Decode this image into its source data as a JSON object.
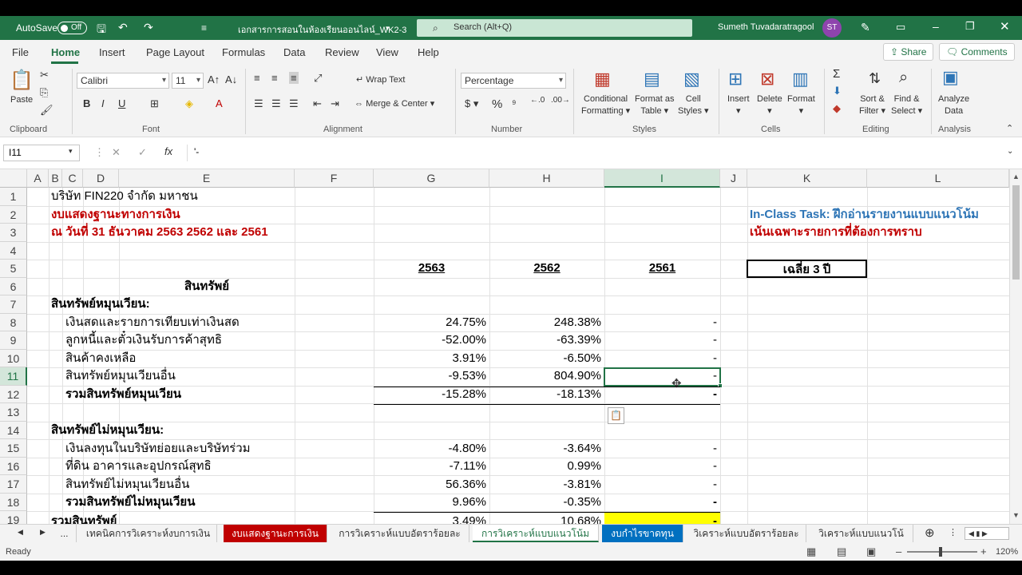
{
  "titlebar": {
    "autosave": "AutoSave",
    "toggle": "Off",
    "filename": "เอกสารการสอนในห้องเรียนออนไลน์_WK2-3",
    "search": "Search (Alt+Q)",
    "user": "Sumeth Tuvadaratragool",
    "initials": "ST"
  },
  "menu": {
    "items": [
      "File",
      "Home",
      "Insert",
      "Page Layout",
      "Formulas",
      "Data",
      "Review",
      "View",
      "Help"
    ],
    "share": "Share",
    "comments": "Comments"
  },
  "ribbon": {
    "paste": "Paste",
    "clipboard": "Clipboard",
    "font_name": "Calibri",
    "font_size": "11",
    "font": "Font",
    "wrap_text": "Wrap Text",
    "merge_center": "Merge & Center",
    "alignment": "Alignment",
    "number_format": "Percentage",
    "number": "Number",
    "cond_fmt_1": "Conditional",
    "cond_fmt_2": "Formatting",
    "fmt_table_1": "Format as",
    "fmt_table_2": "Table",
    "cell_styles_1": "Cell",
    "cell_styles_2": "Styles",
    "styles": "Styles",
    "insert": "Insert",
    "delete": "Delete",
    "format": "Format",
    "cells": "Cells",
    "sort_1": "Sort &",
    "sort_2": "Filter",
    "find_1": "Find &",
    "find_2": "Select",
    "editing": "Editing",
    "analyze_1": "Analyze",
    "analyze_2": "Data",
    "analysis": "Analysis"
  },
  "formula": {
    "namebox": "I11",
    "content": "'-"
  },
  "columns": [
    "A",
    "B",
    "C",
    "D",
    "E",
    "F",
    "G",
    "H",
    "I",
    "J",
    "K",
    "L"
  ],
  "rows": [
    "1",
    "2",
    "3",
    "4",
    "5",
    "6",
    "7",
    "8",
    "9",
    "10",
    "11",
    "12",
    "13",
    "14",
    "15",
    "16",
    "17",
    "18",
    "19"
  ],
  "sheet": {
    "r1": "บริษัท FIN220 จำกัด มหาชน",
    "r2": "งบแสดงฐานะทางการเงิน",
    "r3": "ณ วันที่ 31 ธันวาคม 2563 2562 และ 2561",
    "task1": "In-Class Task: ฝึกอ่านรายงานแบบแนวโน้ม",
    "task2": "เน้นเฉพาะรายการที่ต้องการทราบ",
    "y2563": "2563",
    "y2562": "2562",
    "y2561": "2561",
    "avg": "เฉลี่ย 3 ปี",
    "assets": "สินทรัพย์",
    "current": "สินทรัพย์หมุนเวียน:",
    "items": [
      {
        "label": "เงินสดและรายการเทียบเท่าเงินสด",
        "g": "24.75%",
        "h": "248.38%",
        "i": "-"
      },
      {
        "label": "ลูกหนี้และตั๋วเงินรับการค้าสุทธิ",
        "g": "-52.00%",
        "h": "-63.39%",
        "i": "-"
      },
      {
        "label": "สินค้าคงเหลือ",
        "g": "3.91%",
        "h": "-6.50%",
        "i": "-"
      },
      {
        "label": "สินทรัพย์หมุนเวียนอื่น",
        "g": "-9.53%",
        "h": "804.90%",
        "i": "-"
      },
      {
        "label": "รวมสินทรัพย์หมุนเวียน",
        "g": "-15.28%",
        "h": "-18.13%",
        "i": "-"
      }
    ],
    "noncurrent": "สินทรัพย์ไม่หมุนเวียน:",
    "items2": [
      {
        "label": "เงินลงทุนในบริษัทย่อยและบริษัทร่วม",
        "g": "-4.80%",
        "h": "-3.64%",
        "i": "-"
      },
      {
        "label": "ที่ดิน อาคารและอุปกรณ์สุทธิ",
        "g": "-7.11%",
        "h": "0.99%",
        "i": "-"
      },
      {
        "label": "สินทรัพย์ไม่หมุนเวียนอื่น",
        "g": "56.36%",
        "h": "-3.81%",
        "i": "-"
      },
      {
        "label": "รวมสินทรัพย์ไม่หมุนเวียน",
        "g": "9.96%",
        "h": "-0.35%",
        "i": "-"
      }
    ],
    "r19": "รวมสินทรัพย์",
    "r19g": "3.49%",
    "r19h": "10.68%",
    "r19i": "-"
  },
  "tabs": [
    "...",
    "เทคนิคการวิเคราะห์งบการเงิน",
    "งบแสดงฐานะการเงิน",
    "การวิเคราะห์แบบอัตราร้อยละ",
    "การวิเคราะห์แบบแนวโน้ม",
    "งบกำไรขาดทุน",
    "วิเคราะห์แบบอัตราร้อยละ",
    "วิเคราะห์แบบแนวโน้"
  ],
  "status": {
    "ready": "Ready",
    "zoom": "120%"
  }
}
